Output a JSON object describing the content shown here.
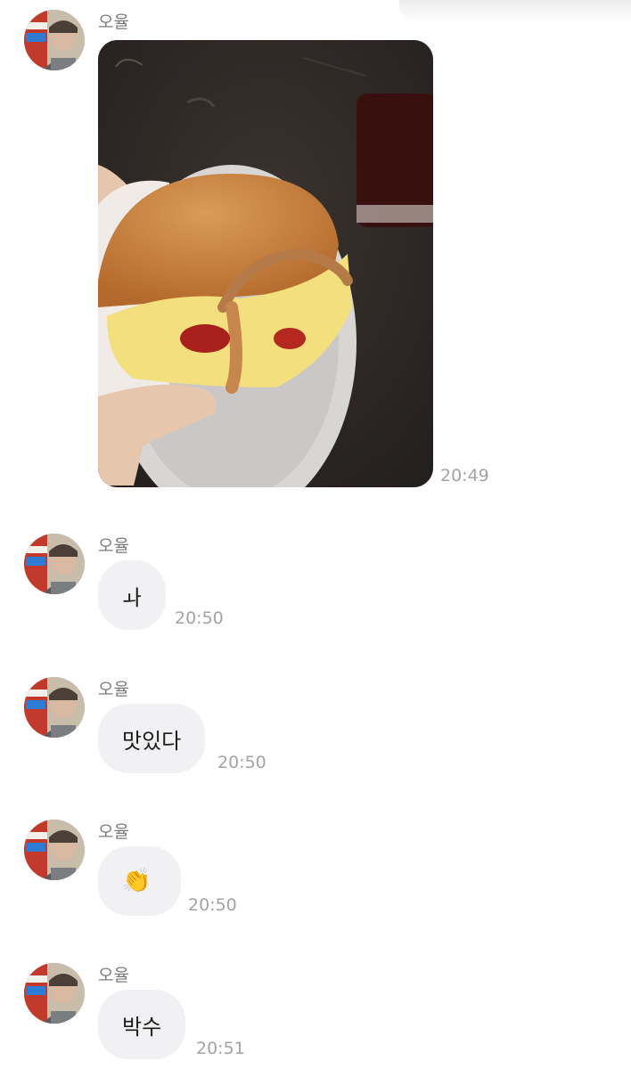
{
  "messages": [
    {
      "sender": "오율",
      "type": "image",
      "time": "20:49"
    },
    {
      "sender": "오율",
      "type": "text",
      "text": "ㅘ",
      "time": "20:50"
    },
    {
      "sender": "오율",
      "type": "text",
      "text": "맛있다",
      "time": "20:50"
    },
    {
      "sender": "오율",
      "type": "text",
      "text": "👏",
      "time": "20:50"
    },
    {
      "sender": "오율",
      "type": "text",
      "text": "박수",
      "time": "20:51"
    }
  ],
  "colors": {
    "bubble": "#f1f1f3",
    "sender_text": "#7b7b7b",
    "time_text": "#a3a3a3",
    "message_text": "#1c1c1c"
  },
  "icons": {
    "clap": "clapping-hands-icon"
  }
}
